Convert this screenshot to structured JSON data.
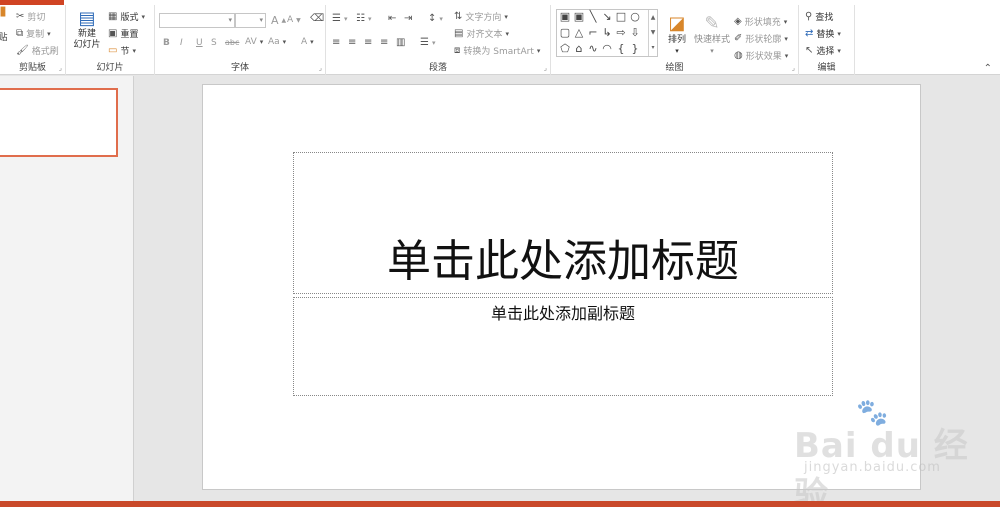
{
  "ribbon": {
    "clipboard": {
      "paste_label": "贴",
      "cut": "剪切",
      "copy": "复制",
      "format_painter": "格式刷",
      "group_label": "剪贴板"
    },
    "slides": {
      "new_slide_line1": "新建",
      "new_slide_line2": "幻灯片",
      "layout": "版式",
      "reset": "重置",
      "section": "节",
      "group_label": "幻灯片"
    },
    "font": {
      "font_name": "",
      "font_size": "",
      "bold": "B",
      "italic": "I",
      "underline": "U",
      "strike": "S",
      "abc": "abc",
      "spacing": "AV",
      "case": "Aa",
      "color": "A",
      "grow": "A",
      "shrink": "A",
      "group_label": "字体"
    },
    "paragraph": {
      "text_direction": "文字方向",
      "align_text": "对齐文本",
      "convert_smartart": "转换为 SmartArt",
      "group_label": "段落"
    },
    "drawing": {
      "arrange": "排列",
      "quick_styles": "快速样式",
      "shape_fill": "形状填充",
      "shape_outline": "形状轮廓",
      "shape_effects": "形状效果",
      "group_label": "绘图"
    },
    "editing": {
      "find": "查找",
      "replace": "替换",
      "select": "选择",
      "group_label": "编辑"
    }
  },
  "slide": {
    "title_placeholder": "单击此处添加标题",
    "subtitle_placeholder": "单击此处添加副标题"
  },
  "watermark": {
    "brand": "Bai du 经验",
    "url": "jingyan.baidu.com"
  },
  "colors": {
    "accent": "#d04423",
    "thumb_border": "#e06d4c",
    "status": "#c9492a"
  }
}
